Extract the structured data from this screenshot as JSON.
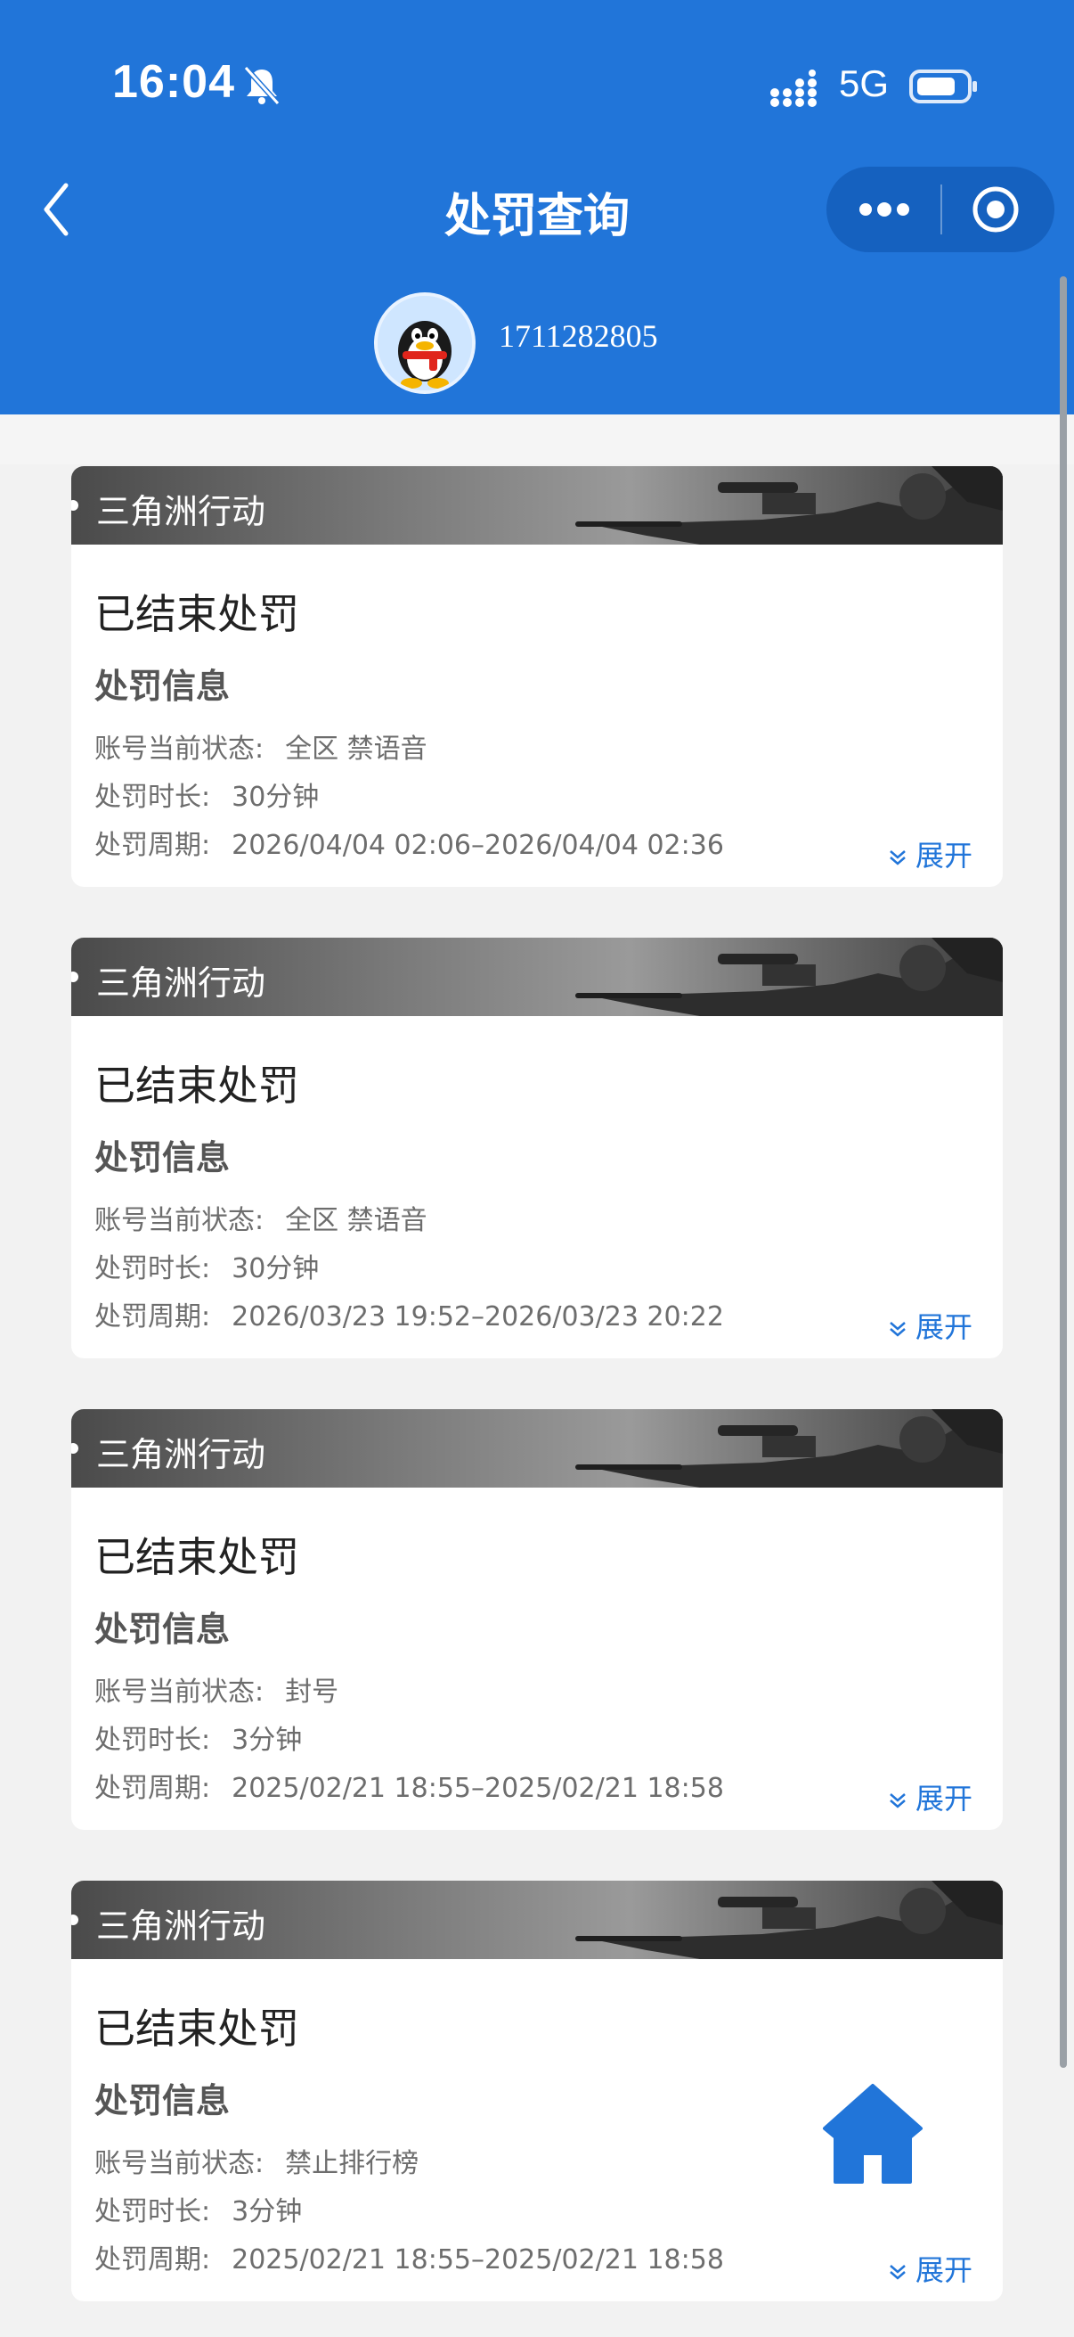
{
  "status_bar": {
    "time": "16:04",
    "network": "5G"
  },
  "header": {
    "title": "处罚查询"
  },
  "user": {
    "id": "1711282805"
  },
  "records": [
    {
      "game": "三角洲行动",
      "status": "已结束处罚",
      "section_title": "处罚信息",
      "state_label": "账号当前状态:",
      "state_value": "全区 禁语音",
      "duration_label": "处罚时长:",
      "duration_value": "30分钟",
      "period_label": "处罚周期:",
      "period_value": "2026/04/04 02:06–2026/04/04 02:36",
      "expand_label": "展开"
    },
    {
      "game": "三角洲行动",
      "status": "已结束处罚",
      "section_title": "处罚信息",
      "state_label": "账号当前状态:",
      "state_value": "全区 禁语音",
      "duration_label": "处罚时长:",
      "duration_value": "30分钟",
      "period_label": "处罚周期:",
      "period_value": "2026/03/23 19:52–2026/03/23 20:22",
      "expand_label": "展开"
    },
    {
      "game": "三角洲行动",
      "status": "已结束处罚",
      "section_title": "处罚信息",
      "state_label": "账号当前状态:",
      "state_value": "封号",
      "duration_label": "处罚时长:",
      "duration_value": "3分钟",
      "period_label": "处罚周期:",
      "period_value": "2025/02/21 18:55–2025/02/21 18:58",
      "expand_label": "展开"
    },
    {
      "game": "三角洲行动",
      "status": "已结束处罚",
      "section_title": "处罚信息",
      "state_label": "账号当前状态:",
      "state_value": "禁止排行榜",
      "duration_label": "处罚时长:",
      "duration_value": "3分钟",
      "period_label": "处罚周期:",
      "period_value": "2025/02/21 18:55–2025/02/21 18:58",
      "expand_label": "展开"
    }
  ],
  "colors": {
    "brand": "#2175d9",
    "page_bg": "#f2f2f2",
    "card_bg": "#ffffff"
  },
  "icons": [
    "bell-muted-icon",
    "signal-icon",
    "battery-icon",
    "back-arrow-icon",
    "more-dots-icon",
    "close-target-icon",
    "qq-penguin-avatar",
    "chevron-double-down-icon",
    "home-icon"
  ]
}
